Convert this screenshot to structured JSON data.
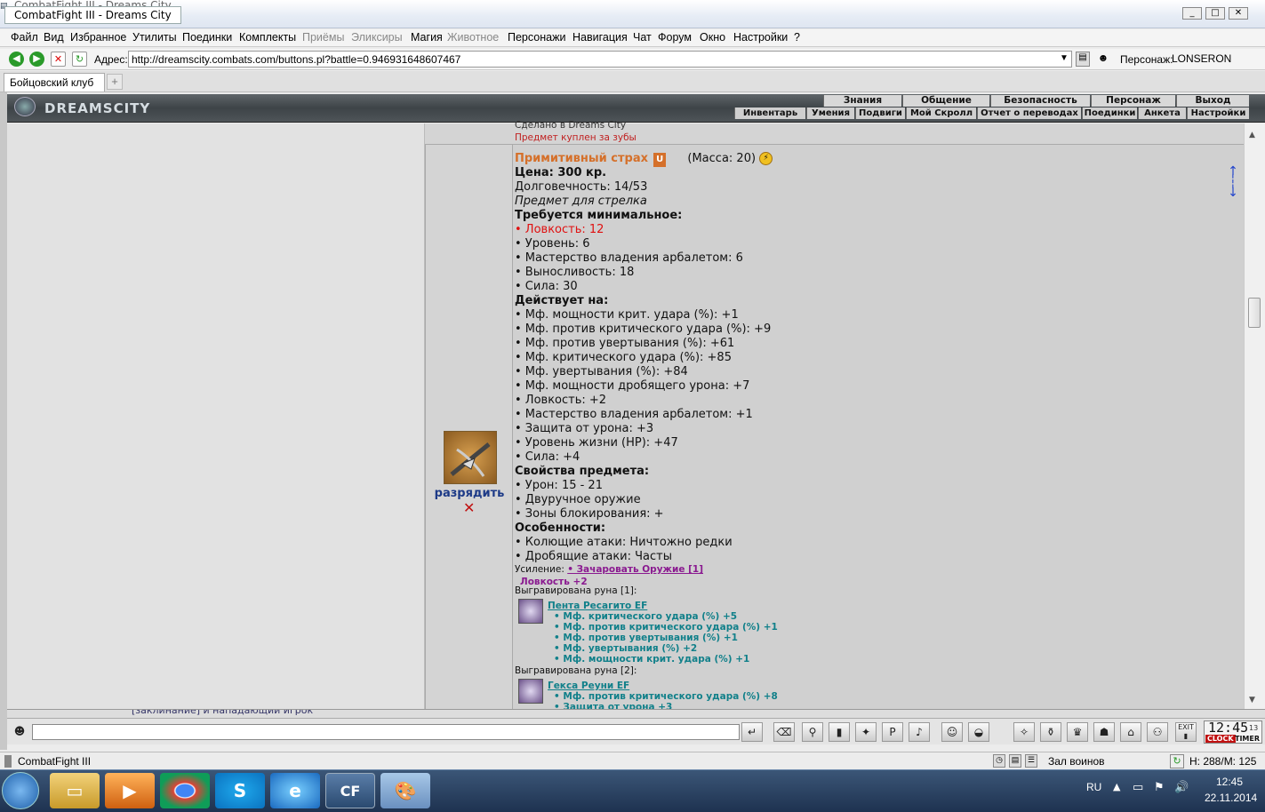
{
  "window": {
    "title": "CombatFight III - Dreams City",
    "ghost_title": "CombatFight III - Dreams City"
  },
  "menu": {
    "items": [
      "Файл",
      "Вид",
      "Избранное",
      "Утилиты",
      "Поединки",
      "Комплекты",
      "Приёмы",
      "Эликсиры",
      "Магия",
      "Животное",
      "Персонажи",
      "Навигация",
      "Чат",
      "Форум",
      "Окно",
      "Настройки",
      "?"
    ]
  },
  "address": {
    "label": "Адрес:",
    "url": "http://dreamscity.combats.com/buttons.pl?battle=0.946931648607467",
    "char_label": "Персонаж:",
    "char_name": "LONSERON"
  },
  "tabs": {
    "active": "Бойцовский клуб",
    "add": "+"
  },
  "dc": {
    "logo": "DREAMSCITY",
    "top": [
      "Знания",
      "Общение",
      "Безопасность",
      "Персонаж",
      "Выход"
    ],
    "bottom": [
      "Инвентарь",
      "Умения",
      "Подвиги",
      "Мой Скролл",
      "Отчет о переводах",
      "Поединки",
      "Анкета",
      "Настройки"
    ]
  },
  "prev": {
    "line1": "Сделано в Dreams City",
    "line2": "Предмет куплен за зубы"
  },
  "item": {
    "name": "Примитивный страх",
    "badge": "U",
    "mass": "(Масса: 20)",
    "price": "Цена: 300 кр.",
    "durability": "Долговечность: 14/53",
    "type": "Предмет для стрелка",
    "req_title": "Требуется минимальное:",
    "req_red": "• Ловкость: 12",
    "reqs": [
      "• Уровень: 6",
      "• Мастерство владения арбалетом: 6",
      "• Выносливость: 18",
      "• Сила: 30"
    ],
    "acts_title": "Действует на:",
    "acts": [
      "• Мф. мощности крит. удара (%): +1",
      "• Мф. против критического удара (%): +9",
      "• Мф. против увертывания (%): +61",
      "• Мф. критического удара (%): +85",
      "• Мф. увертывания (%): +84",
      "• Мф. мощности дробящего урона: +7",
      "• Ловкость: +2",
      "• Мастерство владения арбалетом: +1",
      "• Защита от урона: +3",
      "• Уровень жизни (HP): +47",
      "• Сила: +4"
    ],
    "props_title": "Свойства предмета:",
    "props": [
      "• Урон: 15 - 21",
      "• Двуручное оружие",
      "• Зоны блокирования: +"
    ],
    "feat_title": "Особенности:",
    "feats": [
      "• Колющие атаки: Ничтожно редки",
      "• Дробящие атаки: Часты"
    ],
    "enh_label": "Усиление:",
    "enh_link": "• Зачаровать Оружие [1]",
    "enh_bonus": "Ловкость +2",
    "rune1_label": "Выгравирована руна [1]:",
    "rune1_name": "Пента Ресагито EF",
    "rune1_stats": [
      "• Мф. критического удара (%) +5",
      "• Мф. против критического удара (%) +1",
      "• Мф. против увертывания (%) +1",
      "• Мф. увертывания (%) +2",
      "• Мф. мощности крит. удара (%) +1"
    ],
    "rune2_label": "Выгравирована руна [2]:",
    "rune2_name": "Гекса Реуни EF",
    "rune2_stats": [
      "• Мф. против критического удара (%) +8",
      "• Защита от урона +3"
    ],
    "uncharge": "разрядить",
    "close": "✕"
  },
  "chat": {
    "overflow": "[заклинание] и нападающий игрок"
  },
  "clock": {
    "time": "12:45",
    "sec": "13",
    "clock_label": "CLOCK",
    "timer_label": "TIMER",
    "exit_label": "EXIT"
  },
  "status": {
    "app": "CombatFight III",
    "room": "Зал воинов",
    "hp": "H: 288/M: 125"
  },
  "taskbar": {
    "lang": "RU",
    "time": "12:45",
    "date": "22.11.2014"
  }
}
